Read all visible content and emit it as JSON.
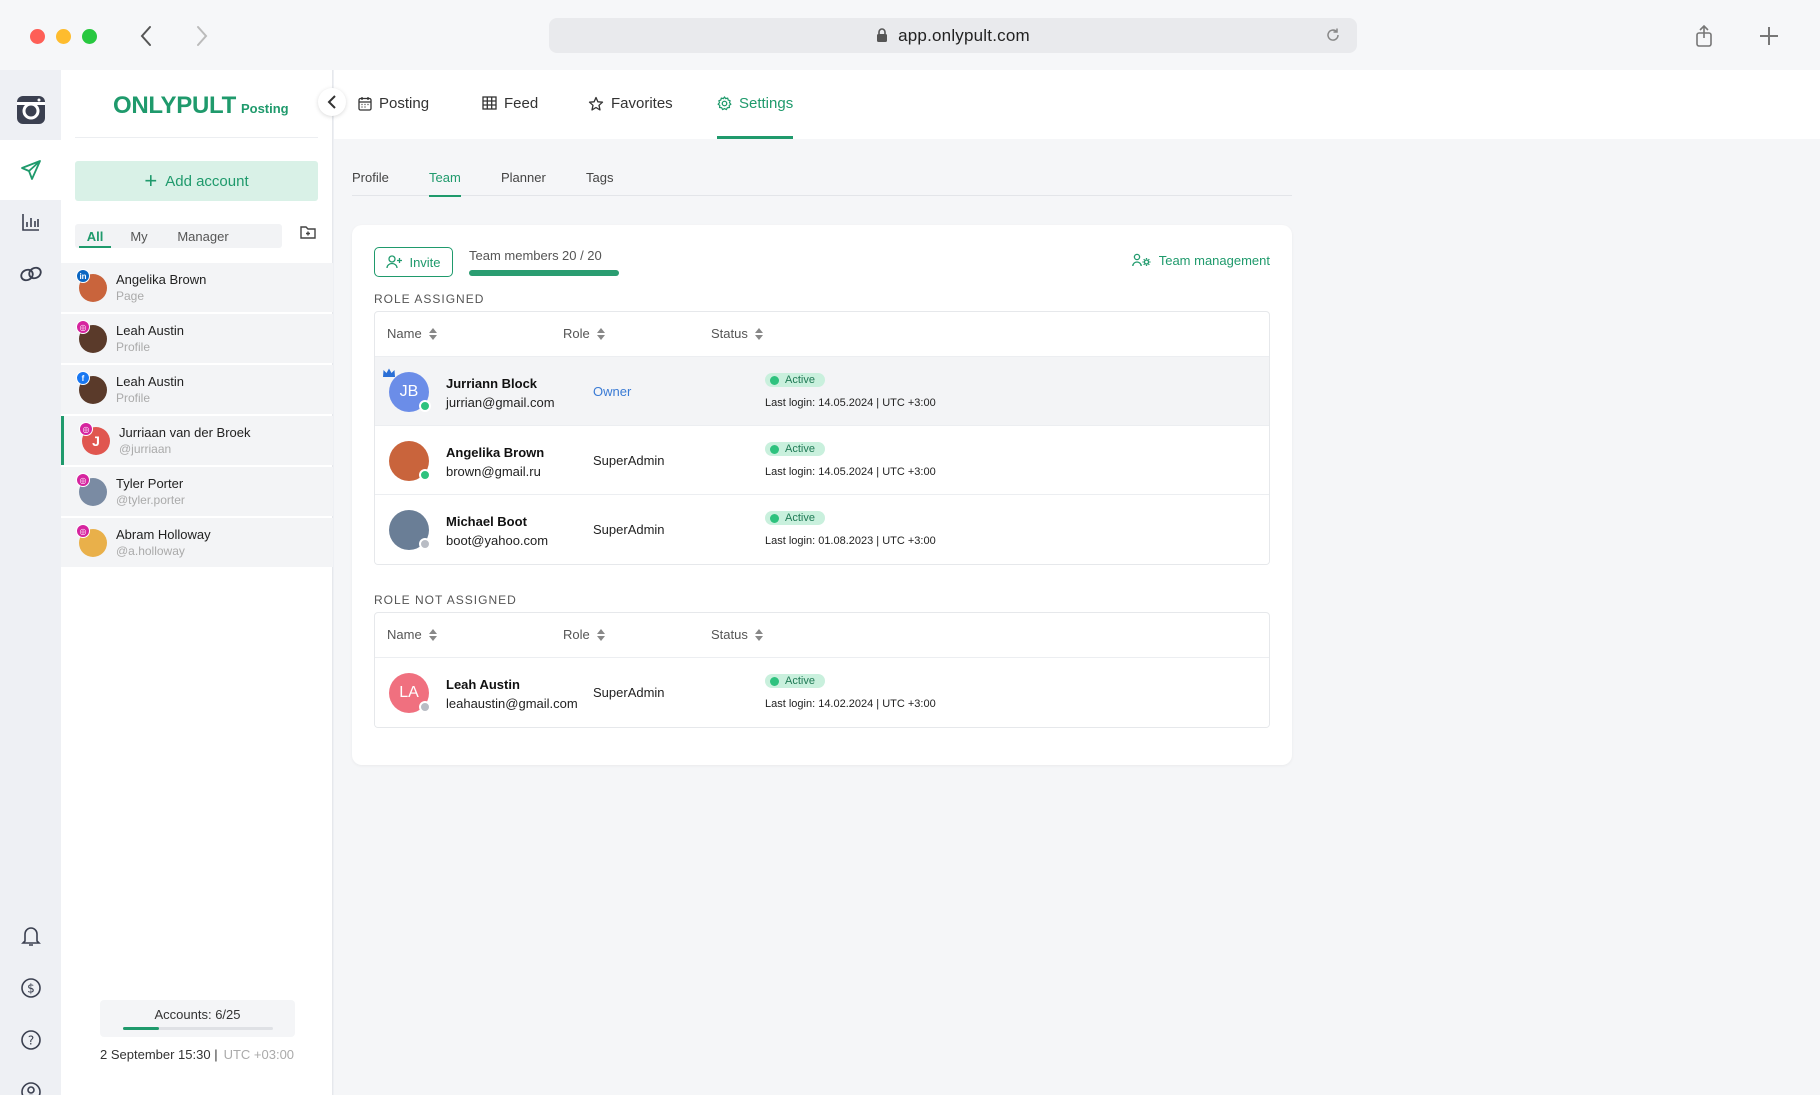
{
  "browser": {
    "url": "app.onlypult.com"
  },
  "brand": {
    "name": "ONLYPULT",
    "product": "Posting",
    "accent": "#1f9a6c"
  },
  "sidebar": {
    "add_account_label": "Add account",
    "filters": [
      "All",
      "My",
      "Manager"
    ],
    "active_filter": "All",
    "accounts": [
      {
        "name": "Angelika Brown",
        "sub": "Page",
        "network": "linkedin",
        "badge": "in",
        "badge_color": "#0a66c2",
        "avatar_color": "#c9643c"
      },
      {
        "name": "Leah Austin",
        "sub": "Profile",
        "network": "instagram",
        "badge": "◎",
        "badge_color": "#d6249f",
        "avatar_color": "#5a3a2a"
      },
      {
        "name": "Leah Austin",
        "sub": "Profile",
        "network": "facebook",
        "badge": "f",
        "badge_color": "#1877f2",
        "avatar_color": "#5a3a2a"
      },
      {
        "name": "Jurriaan van der Broek",
        "sub": "@jurriaan",
        "network": "instagram",
        "badge": "◎",
        "badge_color": "#d6249f",
        "avatar_color": "#e0564f",
        "initial": "J"
      },
      {
        "name": "Tyler Porter",
        "sub": "@tyler.porter",
        "network": "instagram",
        "badge": "◎",
        "badge_color": "#d6249f",
        "avatar_color": "#7a8ba3"
      },
      {
        "name": "Abram Holloway",
        "sub": "@a.holloway",
        "network": "instagram",
        "badge": "◎",
        "badge_color": "#d6249f",
        "avatar_color": "#e9b04a"
      }
    ],
    "accounts_summary": "Accounts: 6/25",
    "accounts_used_fraction": 0.24,
    "datetime": "2 September 15:30 |",
    "timezone": "UTC +03:00"
  },
  "topnav": {
    "tabs": [
      {
        "label": "Posting",
        "icon": "calendar-icon"
      },
      {
        "label": "Feed",
        "icon": "grid-icon"
      },
      {
        "label": "Favorites",
        "icon": "star-icon"
      },
      {
        "label": "Settings",
        "icon": "gear-icon"
      }
    ],
    "active": "Settings"
  },
  "settings": {
    "subtabs": [
      "Profile",
      "Team",
      "Planner",
      "Tags"
    ],
    "active_subtab": "Team",
    "invite_label": "Invite",
    "team_members_label": "Team members",
    "team_members_count": "20 / 20",
    "team_members_fraction": 1.0,
    "team_management_label": "Team management",
    "columns": {
      "name": "Name",
      "role": "Role",
      "status": "Status"
    },
    "role_assigned_title": "ROLE ASSIGNED",
    "role_not_assigned_title": "ROLE NOT ASSIGNED",
    "role_assigned": [
      {
        "name": "Jurriann Block",
        "email": "jurrian@gmail.com",
        "role": "Owner",
        "status": "Active",
        "last_login": "Last login: 14.05.2024 |  UTC +3:00",
        "initials": "JB",
        "avatar_color": "#6b8de8",
        "online": true,
        "owner": true
      },
      {
        "name": "Angelika Brown",
        "email": "brown@gmail.ru",
        "role": "SuperAdmin",
        "status": "Active",
        "last_login": "Last login: 14.05.2024 |  UTC +3:00",
        "initials": "",
        "avatar_color": "#c9643c",
        "online": true,
        "owner": false
      },
      {
        "name": "Michael Boot",
        "email": "boot@yahoo.com",
        "role": "SuperAdmin",
        "status": "Active",
        "last_login": "Last login: 01.08.2023 |  UTC +3:00",
        "initials": "",
        "avatar_color": "#6a7e96",
        "online": false,
        "owner": false
      }
    ],
    "role_not_assigned": [
      {
        "name": "Leah Austin",
        "email": "leahaustin@gmail.com",
        "role": "SuperAdmin",
        "status": "Active",
        "last_login": "Last login: 14.02.2024 |  UTC +3:00",
        "initials": "LA",
        "avatar_color": "#f0707f",
        "online": false,
        "owner": false
      }
    ],
    "colors": {
      "online": "#2ec27e",
      "offline": "#b8bcc4",
      "owner_role": "#3a7bd5"
    }
  }
}
